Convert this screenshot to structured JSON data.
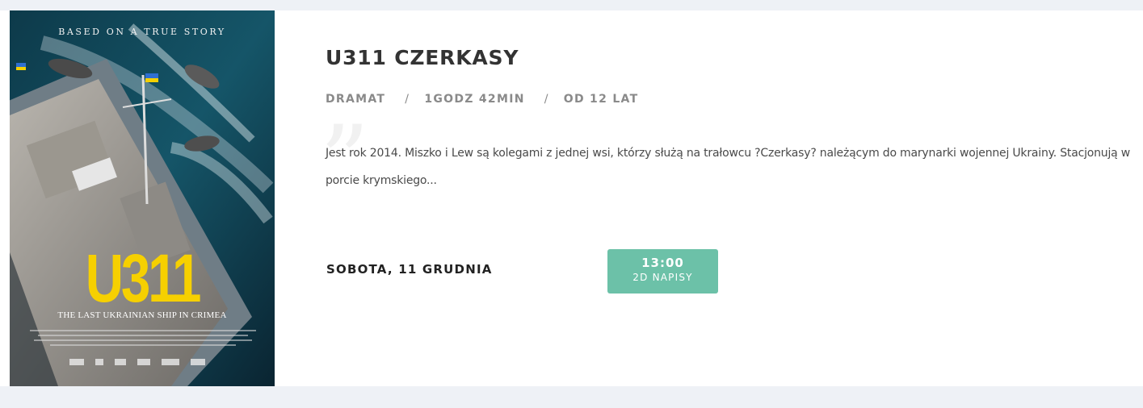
{
  "poster": {
    "tagline": "BASED ON A TRUE STORY",
    "big_title": "U311",
    "subtitle": "THE LAST UKRAINIAN SHIP IN CRIMEA"
  },
  "movie": {
    "title": "U311 CZERKASY",
    "genre": "DRAMAT",
    "separator": "/",
    "duration": "1GODZ 42MIN",
    "age_rating": "OD 12 LAT",
    "description": "Jest rok 2014. Miszko i Lew są kolegami z jednej wsi, którzy służą na trałowcu ?Czerkasy? należącym do marynarki wojennej Ukrainy. Stacjonują w porcie krymskiego..."
  },
  "screening": {
    "date": "SOBOTA, 11 GRUDNIA",
    "time": "13:00",
    "format": "2D NAPISY"
  },
  "colors": {
    "page_bg": "#eef1f6",
    "showtime_button": "#6cc1a8",
    "poster_title": "#f6d000"
  }
}
